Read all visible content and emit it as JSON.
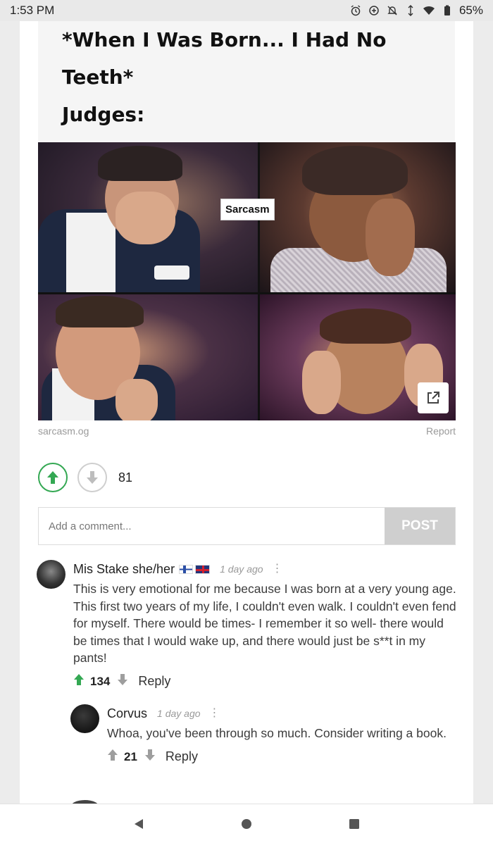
{
  "status_bar": {
    "time": "1:53 PM",
    "battery": "65%",
    "icons": [
      "alarm-icon",
      "data-saver-icon",
      "notifications-off-icon",
      "vibrate-icon",
      "wifi-icon",
      "battery-icon"
    ]
  },
  "post": {
    "title_lines": [
      "*When I Was Born... I Had No",
      "Teeth*",
      "Judges:"
    ],
    "image_label": "Sarcasm",
    "source": "sarcasm.og",
    "report_label": "Report",
    "vote_count": "81"
  },
  "comment_form": {
    "placeholder": "Add a comment...",
    "post_label": "POST"
  },
  "comments": [
    {
      "author": "Mis Stake she/her",
      "time": "1 day ago",
      "text": "This is very emotional for me because I was born at a very young age. This first two years of my life, I couldn't even walk. I couldn't even fend for myself. There would be times- I remember it so well- there would be times that I would wake up, and there would just be s**t in my pants!",
      "score": "134",
      "reply_label": "Reply"
    },
    {
      "author": "Corvus",
      "time": "1 day ago",
      "text": "Whoa, you've been through so much. Consider writing a book.",
      "score": "21",
      "reply_label": "Reply"
    }
  ],
  "nav": {
    "icons": [
      "back-icon",
      "home-icon",
      "recents-icon"
    ]
  },
  "colors": {
    "upvote_green": "#34a853",
    "post_button_bg": "#cfcfcf"
  }
}
